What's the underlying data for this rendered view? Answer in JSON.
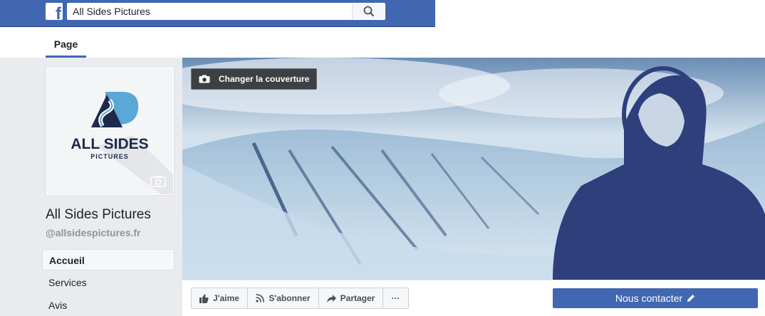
{
  "topbar": {
    "logo_letter": "f",
    "search_value": "All Sides Pictures"
  },
  "tabs": {
    "page_label": "Page"
  },
  "profile": {
    "logo_line1": "ALL SIDES",
    "logo_line2": "PICTURES",
    "name": "All Sides Pictures",
    "handle": "@allsidespictures.fr"
  },
  "nav": {
    "items": [
      {
        "label": "Accueil",
        "active": true
      },
      {
        "label": "Services",
        "active": false
      },
      {
        "label": "Avis",
        "active": false
      }
    ]
  },
  "cover": {
    "change_label": "Changer la couverture"
  },
  "actions": {
    "like_label": "J'aime",
    "follow_label": "S'abonner",
    "share_label": "Partager",
    "more_label": "···",
    "contact_label": "Nous contacter"
  },
  "colors": {
    "brand_blue": "#4267b2",
    "page_bg": "#e9ebee",
    "logo_navy": "#1e2a4a",
    "logo_sky": "#5aa7d8"
  },
  "icons": [
    "facebook-logo-icon",
    "search-icon",
    "camera-icon",
    "thumbs-up-icon",
    "rss-icon",
    "share-arrow-icon",
    "pencil-icon"
  ]
}
